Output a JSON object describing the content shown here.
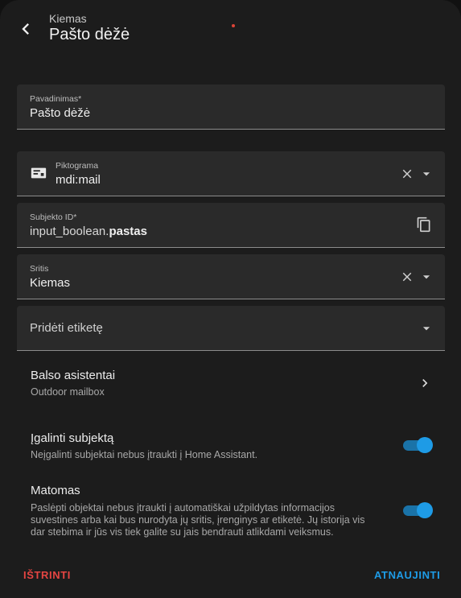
{
  "header": {
    "subtitle": "Kiemas",
    "title": "Pašto dėžė"
  },
  "fields": {
    "name": {
      "label": "Pavadinimas*",
      "value": "Pašto dėžė"
    },
    "icon": {
      "label": "Piktograma",
      "value": "mdi:mail",
      "icon": "mail-icon"
    },
    "entity_id": {
      "label": "Subjekto ID*",
      "prefix": "input_boolean.",
      "suffix": "pastas"
    },
    "area": {
      "label": "Sritis",
      "value": "Kiemas"
    },
    "labels": {
      "placeholder": "Pridėti etiketę"
    }
  },
  "voice": {
    "title": "Balso asistentai",
    "subtitle": "Outdoor mailbox"
  },
  "enable": {
    "title": "Įgalinti subjektą",
    "description": "Neįgalinti subjektai nebus įtraukti į Home Assistant.",
    "on": true
  },
  "visible": {
    "title": "Matomas",
    "description_lines": [
      "Paslėpti objektai nebus įtraukti į automatiškai užpildytas informacijos",
      "suvestines arba kai bus nurodyta jų sritis, įrenginys ar etiketė. Jų istorija vis",
      "dar stebima ir jūs vis tiek galite su jais bendrauti atlikdami veiksmus."
    ],
    "on": true
  },
  "footer": {
    "delete_label": "IŠTRINTI",
    "update_label": "ATNAUJINTI"
  },
  "colors": {
    "accent": "#1e9be6",
    "danger": "#e54542",
    "surface": "#1c1c1c",
    "field_bg": "#2a2a2a"
  }
}
